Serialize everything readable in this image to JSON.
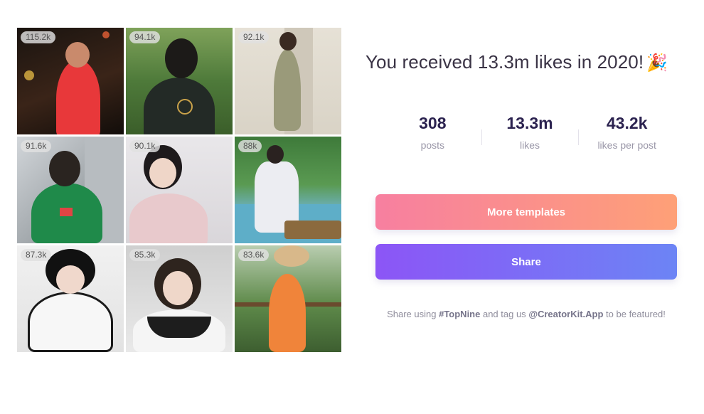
{
  "grid": {
    "tiles": [
      {
        "likes": "115.2k",
        "scene": "night-red-outfit"
      },
      {
        "likes": "94.1k",
        "scene": "green-park-black-tee"
      },
      {
        "likes": "92.1k",
        "scene": "beige-room-olive-dress"
      },
      {
        "likes": "91.6k",
        "scene": "window-green-top"
      },
      {
        "likes": "90.1k",
        "scene": "pink-pajamas-selfie"
      },
      {
        "likes": "88k",
        "scene": "poolside-white-robe"
      },
      {
        "likes": "87.3k",
        "scene": "black-white-jacket"
      },
      {
        "likes": "85.3k",
        "scene": "gold-collar-portrait"
      },
      {
        "likes": "83.6k",
        "scene": "palm-orange-dress"
      }
    ]
  },
  "headline": {
    "text": "You received 13.3m likes in 2020!",
    "emoji": "🎉"
  },
  "stats": [
    {
      "value": "308",
      "label": "posts"
    },
    {
      "value": "13.3m",
      "label": "likes"
    },
    {
      "value": "43.2k",
      "label": "likes per post"
    }
  ],
  "buttons": {
    "templates": "More templates",
    "share": "Share"
  },
  "footer": {
    "prefix": "Share using ",
    "hashtag": "#TopNine",
    "middle": " and tag us ",
    "handle": "@CreatorKit.App",
    "suffix": " to be featured!"
  },
  "colors": {
    "templates_gradient": [
      "#f77fa0",
      "#fea077"
    ],
    "share_gradient": [
      "#8c55f6",
      "#6c84f5"
    ],
    "stat_value": "#2c2350"
  }
}
